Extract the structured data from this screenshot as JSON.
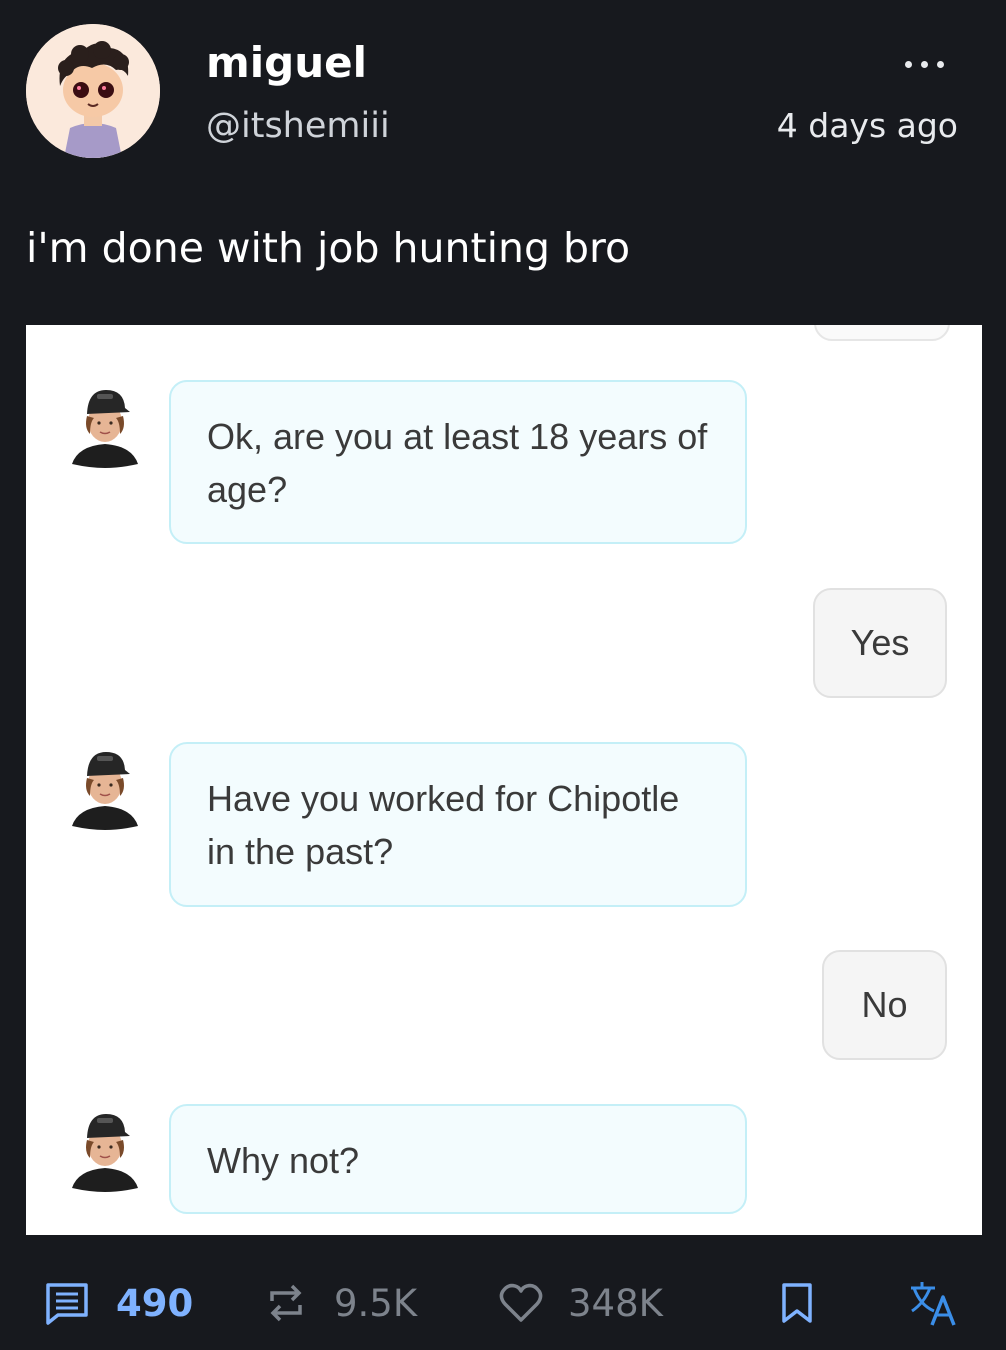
{
  "post": {
    "author_name": "miguel",
    "author_handle": "@itshemiii",
    "timestamp": "4 days ago",
    "text": "i'm done with job hunting bro"
  },
  "chat": {
    "messages": [
      {
        "from": "bot",
        "text": "Ok, are you at least 18 years of age?"
      },
      {
        "from": "user",
        "text": "Yes"
      },
      {
        "from": "bot",
        "text": "Have you worked for Chipotle in the past?"
      },
      {
        "from": "user",
        "text": "No"
      },
      {
        "from": "bot",
        "text": "Why not?"
      }
    ]
  },
  "actions": {
    "replies": "490",
    "reposts": "9.5K",
    "likes": "348K"
  },
  "icons": {
    "more": "more-dots-icon",
    "reply": "comment-icon",
    "repost": "repost-icon",
    "like": "heart-icon",
    "bookmark": "bookmark-icon",
    "translate": "translate-icon"
  },
  "colors": {
    "background": "#17191e",
    "reply_accent": "#7fb2ff",
    "translate_accent": "#3b8ee8",
    "muted": "#7d838c",
    "bot_bubble_bg": "#f3fcfe",
    "bot_bubble_border": "#c4eff7"
  }
}
